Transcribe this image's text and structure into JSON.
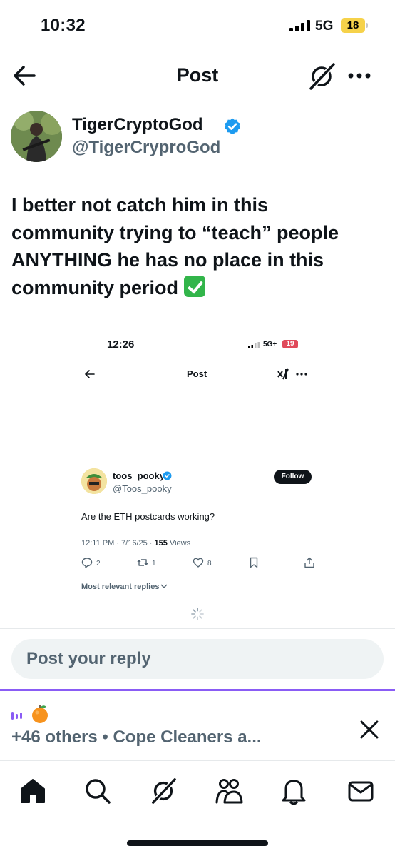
{
  "status_bar": {
    "time": "10:32",
    "network": "5G",
    "battery": "18"
  },
  "nav": {
    "title": "Post"
  },
  "author": {
    "display_name": "TigerCryptoGod",
    "handle": "@TigerCryproGod"
  },
  "post": {
    "text": "I better not catch him in this community trying to “teach” people ANYTHING he has no place in this community period"
  },
  "embed": {
    "status_bar": {
      "time": "12:26",
      "network": "5G+",
      "battery": "19"
    },
    "title": "Post",
    "author": {
      "display_name": "toos_pooky",
      "handle": "@Toos_pooky"
    },
    "follow_label": "Follow",
    "text": "Are the ETH postcards working?",
    "timestamp": "12:11 PM · 7/16/25 · ",
    "views_count": "155",
    "views_label": " Views",
    "reply_count": "2",
    "repost_count": "1",
    "like_count": "8",
    "replies_filter": "Most relevant replies"
  },
  "reply_box": {
    "placeholder": "Post your reply"
  },
  "space_bar": {
    "listeners": "+46 others • Cope Cleaners a..."
  },
  "colors": {
    "accent": "#1d9bf0",
    "space": "#8a5cf5",
    "text": "#0f1419",
    "muted": "#536471"
  }
}
